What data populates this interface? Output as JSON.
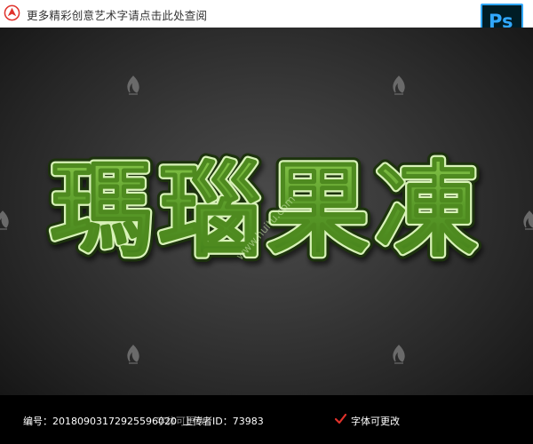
{
  "top_bar": {
    "link_text": "更多精彩创意艺术字请点击此处查阅",
    "ps_badge": "Ps",
    "accent_color": "#e0322b"
  },
  "artwork": {
    "headline": "瑪瑙果凍",
    "style": "green jelly text effect",
    "fill_color": "#5b9c2a",
    "highlight_color": "#d8f2b8",
    "watermark_text": "www.huitu.com",
    "background_color": "#363636"
  },
  "footer": {
    "id_text": "编号：20180903172925596020",
    "uploader_text": "上传者ID：73983",
    "editable_text_1": "字体可更改",
    "editable_text_2": "字体可更改"
  }
}
